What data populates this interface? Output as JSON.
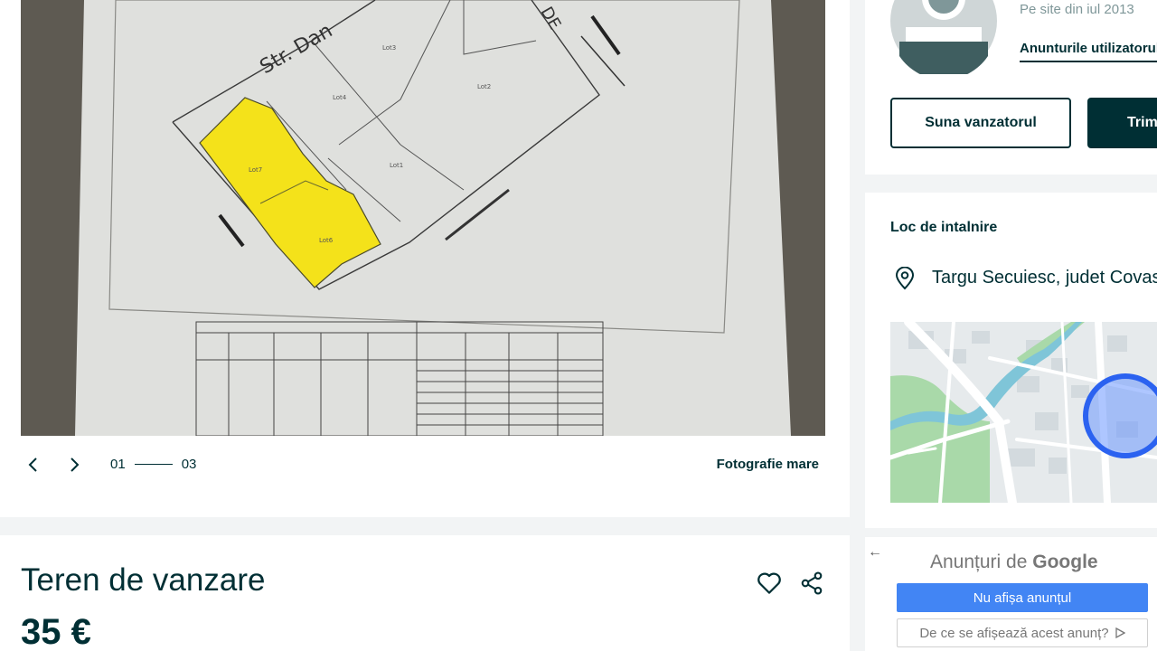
{
  "gallery": {
    "counter_current": "01",
    "counter_total": "03",
    "big_photo_label": "Fotografie mare"
  },
  "listing": {
    "title": "Teren de vanzare",
    "price": "35 €"
  },
  "seller": {
    "member_since": "Pe site din iul 2013",
    "user_ads_link": "Anunturile utilizatorului",
    "call_button": "Suna vanzatorul",
    "send_button": "Trimite mesaj"
  },
  "location": {
    "title": "Loc de intalnire",
    "place": "Targu Secuiesc, judet Covasna"
  },
  "ad": {
    "heading_prefix": "Anunțuri de ",
    "heading_brand": "Google",
    "hide_button": "Nu afișa anunțul",
    "why_button": "De ce se afișează acest anunț?"
  },
  "colors": {
    "brand": "#002f34",
    "background": "#f2f4f5",
    "ad_blue": "#4285f4",
    "highlight_yellow": "#f4e21a"
  },
  "icons": {
    "prev": "chevron-left-icon",
    "next": "chevron-right-icon",
    "favorite": "heart-icon",
    "share": "share-icon",
    "location": "location-pin-icon"
  }
}
